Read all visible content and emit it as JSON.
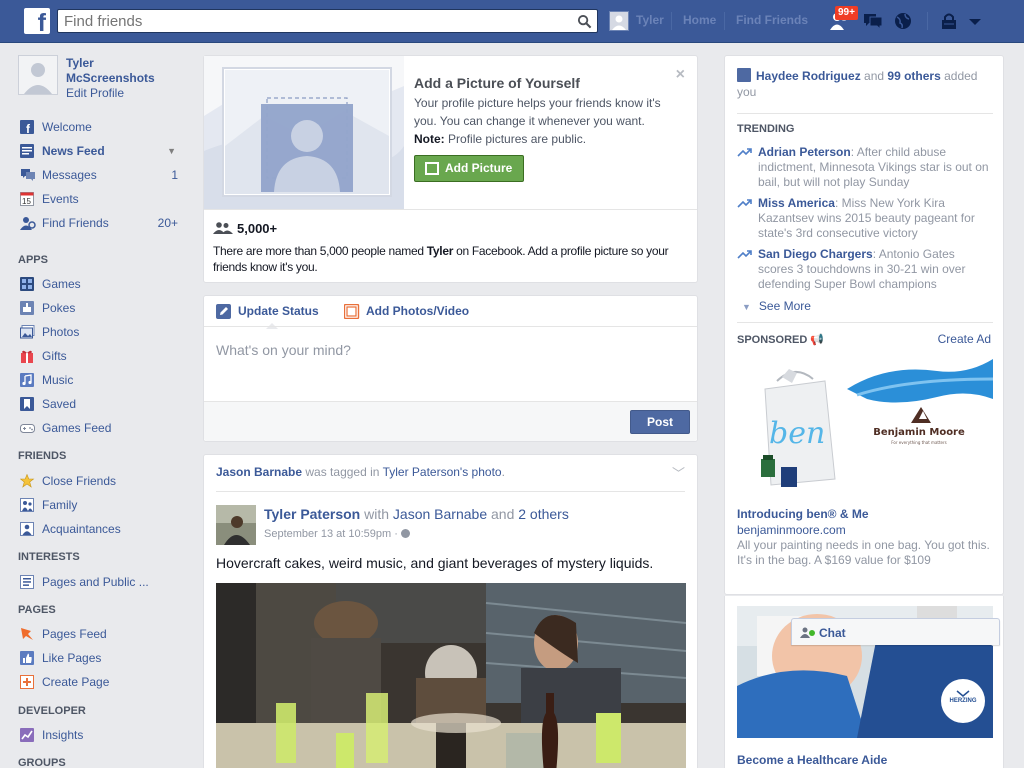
{
  "topbar": {
    "logo": "f",
    "search_placeholder": "Find friends",
    "user_name": "Tyler",
    "home": "Home",
    "find_friends": "Find Friends",
    "notification_count": "99+"
  },
  "profile": {
    "name": "Tyler McScreenshots",
    "edit": "Edit Profile"
  },
  "nav": {
    "main": [
      {
        "label": "Welcome",
        "icon": "facebook-icon"
      },
      {
        "label": "News Feed",
        "icon": "news-feed-icon"
      },
      {
        "label": "Messages",
        "count": "1",
        "icon": "messages-icon"
      },
      {
        "label": "Events",
        "icon": "calendar-icon"
      },
      {
        "label": "Find Friends",
        "count": "20+",
        "icon": "find-friends-icon"
      }
    ],
    "apps_title": "APPS",
    "apps": [
      {
        "label": "Games",
        "icon": "games-icon"
      },
      {
        "label": "Pokes",
        "icon": "pokes-icon"
      },
      {
        "label": "Photos",
        "icon": "photos-icon"
      },
      {
        "label": "Gifts",
        "icon": "gift-icon"
      },
      {
        "label": "Music",
        "icon": "music-icon"
      },
      {
        "label": "Saved",
        "icon": "bookmark-icon"
      },
      {
        "label": "Games Feed",
        "icon": "gamepad-icon"
      }
    ],
    "friends_title": "FRIENDS",
    "friends": [
      {
        "label": "Close Friends",
        "icon": "star-icon"
      },
      {
        "label": "Family",
        "icon": "family-icon"
      },
      {
        "label": "Acquaintances",
        "icon": "acquaintances-icon"
      }
    ],
    "interests_title": "INTERESTS",
    "interests": [
      {
        "label": "Pages and Public ...",
        "icon": "list-icon"
      }
    ],
    "pages_title": "PAGES",
    "pages": [
      {
        "label": "Pages Feed",
        "icon": "pages-feed-icon"
      },
      {
        "label": "Like Pages",
        "icon": "thumbs-up-icon"
      },
      {
        "label": "Create Page",
        "icon": "plus-icon"
      }
    ],
    "developer_title": "DEVELOPER",
    "developer": [
      {
        "label": "Insights",
        "icon": "insights-icon"
      }
    ],
    "groups_title": "GROUPS"
  },
  "picture_prompt": {
    "title": "Add a Picture of Yourself",
    "desc": "Your profile picture helps your friends know it's you. You can change it whenever you want.",
    "note_label": "Note:",
    "note_text": "Profile pictures are public.",
    "button": "Add Picture",
    "close": "×",
    "count": "5,000+",
    "people_pre": "There are more than 5,000 people named ",
    "people_name": "Tyler",
    "people_post": " on Facebook. Add a profile picture so your friends know it's you."
  },
  "composer": {
    "tab_status": "Update Status",
    "tab_photos": "Add Photos/Video",
    "placeholder": "What's on your mind?",
    "post": "Post"
  },
  "story": {
    "header_user": "Jason Barnabe",
    "header_mid": " was tagged in ",
    "header_target": "Tyler Paterson's photo",
    "header_end": ".",
    "author": "Tyler Paterson",
    "with": " with ",
    "with_user": "Jason Barnabe",
    "and": " and ",
    "others": "2 others",
    "time": "September 13 at 10:59pm · ",
    "text": "Hovercraft cakes, weird music, and giant beverages of mystery liquids."
  },
  "right": {
    "friend_name": "Haydee Rodriguez",
    "friend_mid": " and ",
    "friend_others": "99 others",
    "friend_end": " added you",
    "trending_title": "TRENDING",
    "trending": [
      {
        "name": "Adrian Peterson",
        "text": ": After child abuse indictment, Minnesota Vikings star is out on bail, but will not play Sunday"
      },
      {
        "name": "Miss America",
        "text": ": Miss New York Kira Kazantsev wins 2015 beauty pageant for state's 3rd consecutive victory"
      },
      {
        "name": "San Diego Chargers",
        "text": ": Antonio Gates scores 3 touchdowns in 30-21 win over defending Super Bowl champions"
      }
    ],
    "see_more": "See More",
    "sponsored_title": "SPONSORED",
    "create_ad": "Create Ad",
    "ad1": {
      "brand": "Benjamin Moore",
      "tagline": "For everything that matters",
      "bag_text": "ben",
      "title": "Introducing ben® & Me",
      "url": "benjaminmoore.com",
      "desc": "All your painting needs in one bag. You got this. It's in the bag. A $169 value for $109"
    },
    "ad2": {
      "badge": "HERZING",
      "title": "Become a Healthcare Aide"
    },
    "chat": "Chat"
  },
  "colors": {
    "brand": "#3b5998",
    "add_picture_green": "#69a74e",
    "notification_red": "#f03d25",
    "online_green": "#42b72a"
  }
}
